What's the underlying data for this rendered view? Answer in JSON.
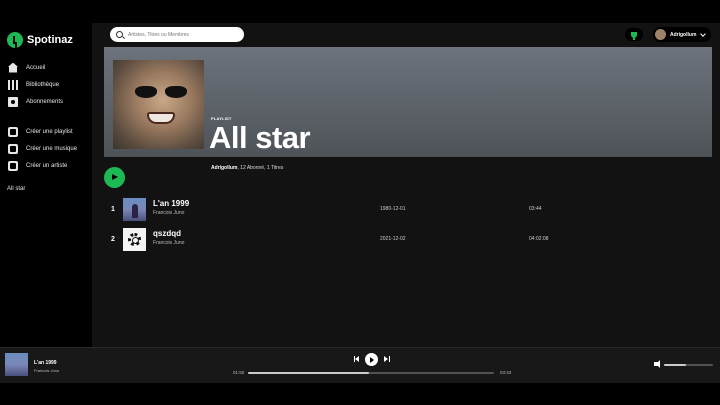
{
  "app": {
    "name": "Spotinaz"
  },
  "sidebar": {
    "main_items": [
      {
        "label": "Accueil",
        "icon": "home-icon"
      },
      {
        "label": "Bibliothèque",
        "icon": "library-icon"
      },
      {
        "label": "Abonnements",
        "icon": "subscriptions-icon"
      }
    ],
    "create_items": [
      {
        "label": "Créer une playlist",
        "icon": "add-playlist-icon"
      },
      {
        "label": "Créer une musique",
        "icon": "add-music-icon"
      },
      {
        "label": "Créer un artiste",
        "icon": "add-artist-icon"
      }
    ],
    "playlists": [
      "All star"
    ]
  },
  "header": {
    "search_placeholder": "Artistes, Titres ou Membres",
    "user_name": "Adrigollum"
  },
  "playlist": {
    "type_label": "PLAYLIST",
    "title": "All star",
    "owner": "Adrigollum",
    "stats": ", 12 Abonné, 1 Titres"
  },
  "tracks": [
    {
      "num": "1",
      "title": "L'an 1999",
      "artist": "Francois Juno",
      "date": "1980-12-01",
      "duration": "03:44"
    },
    {
      "num": "2",
      "title": "qszdqd",
      "artist": "Francois Juno",
      "date": "2021-12-02",
      "duration": "04:02:08"
    }
  ],
  "player": {
    "title": "L'an 1999",
    "artist": "Francois Juno",
    "elapsed": "01:50",
    "total": "03:43",
    "progress_fraction": 0.49,
    "volume_fraction": 0.45
  },
  "colors": {
    "accent": "#1db954",
    "background": "#121212",
    "sidebar": "#000000",
    "player": "#181818"
  }
}
